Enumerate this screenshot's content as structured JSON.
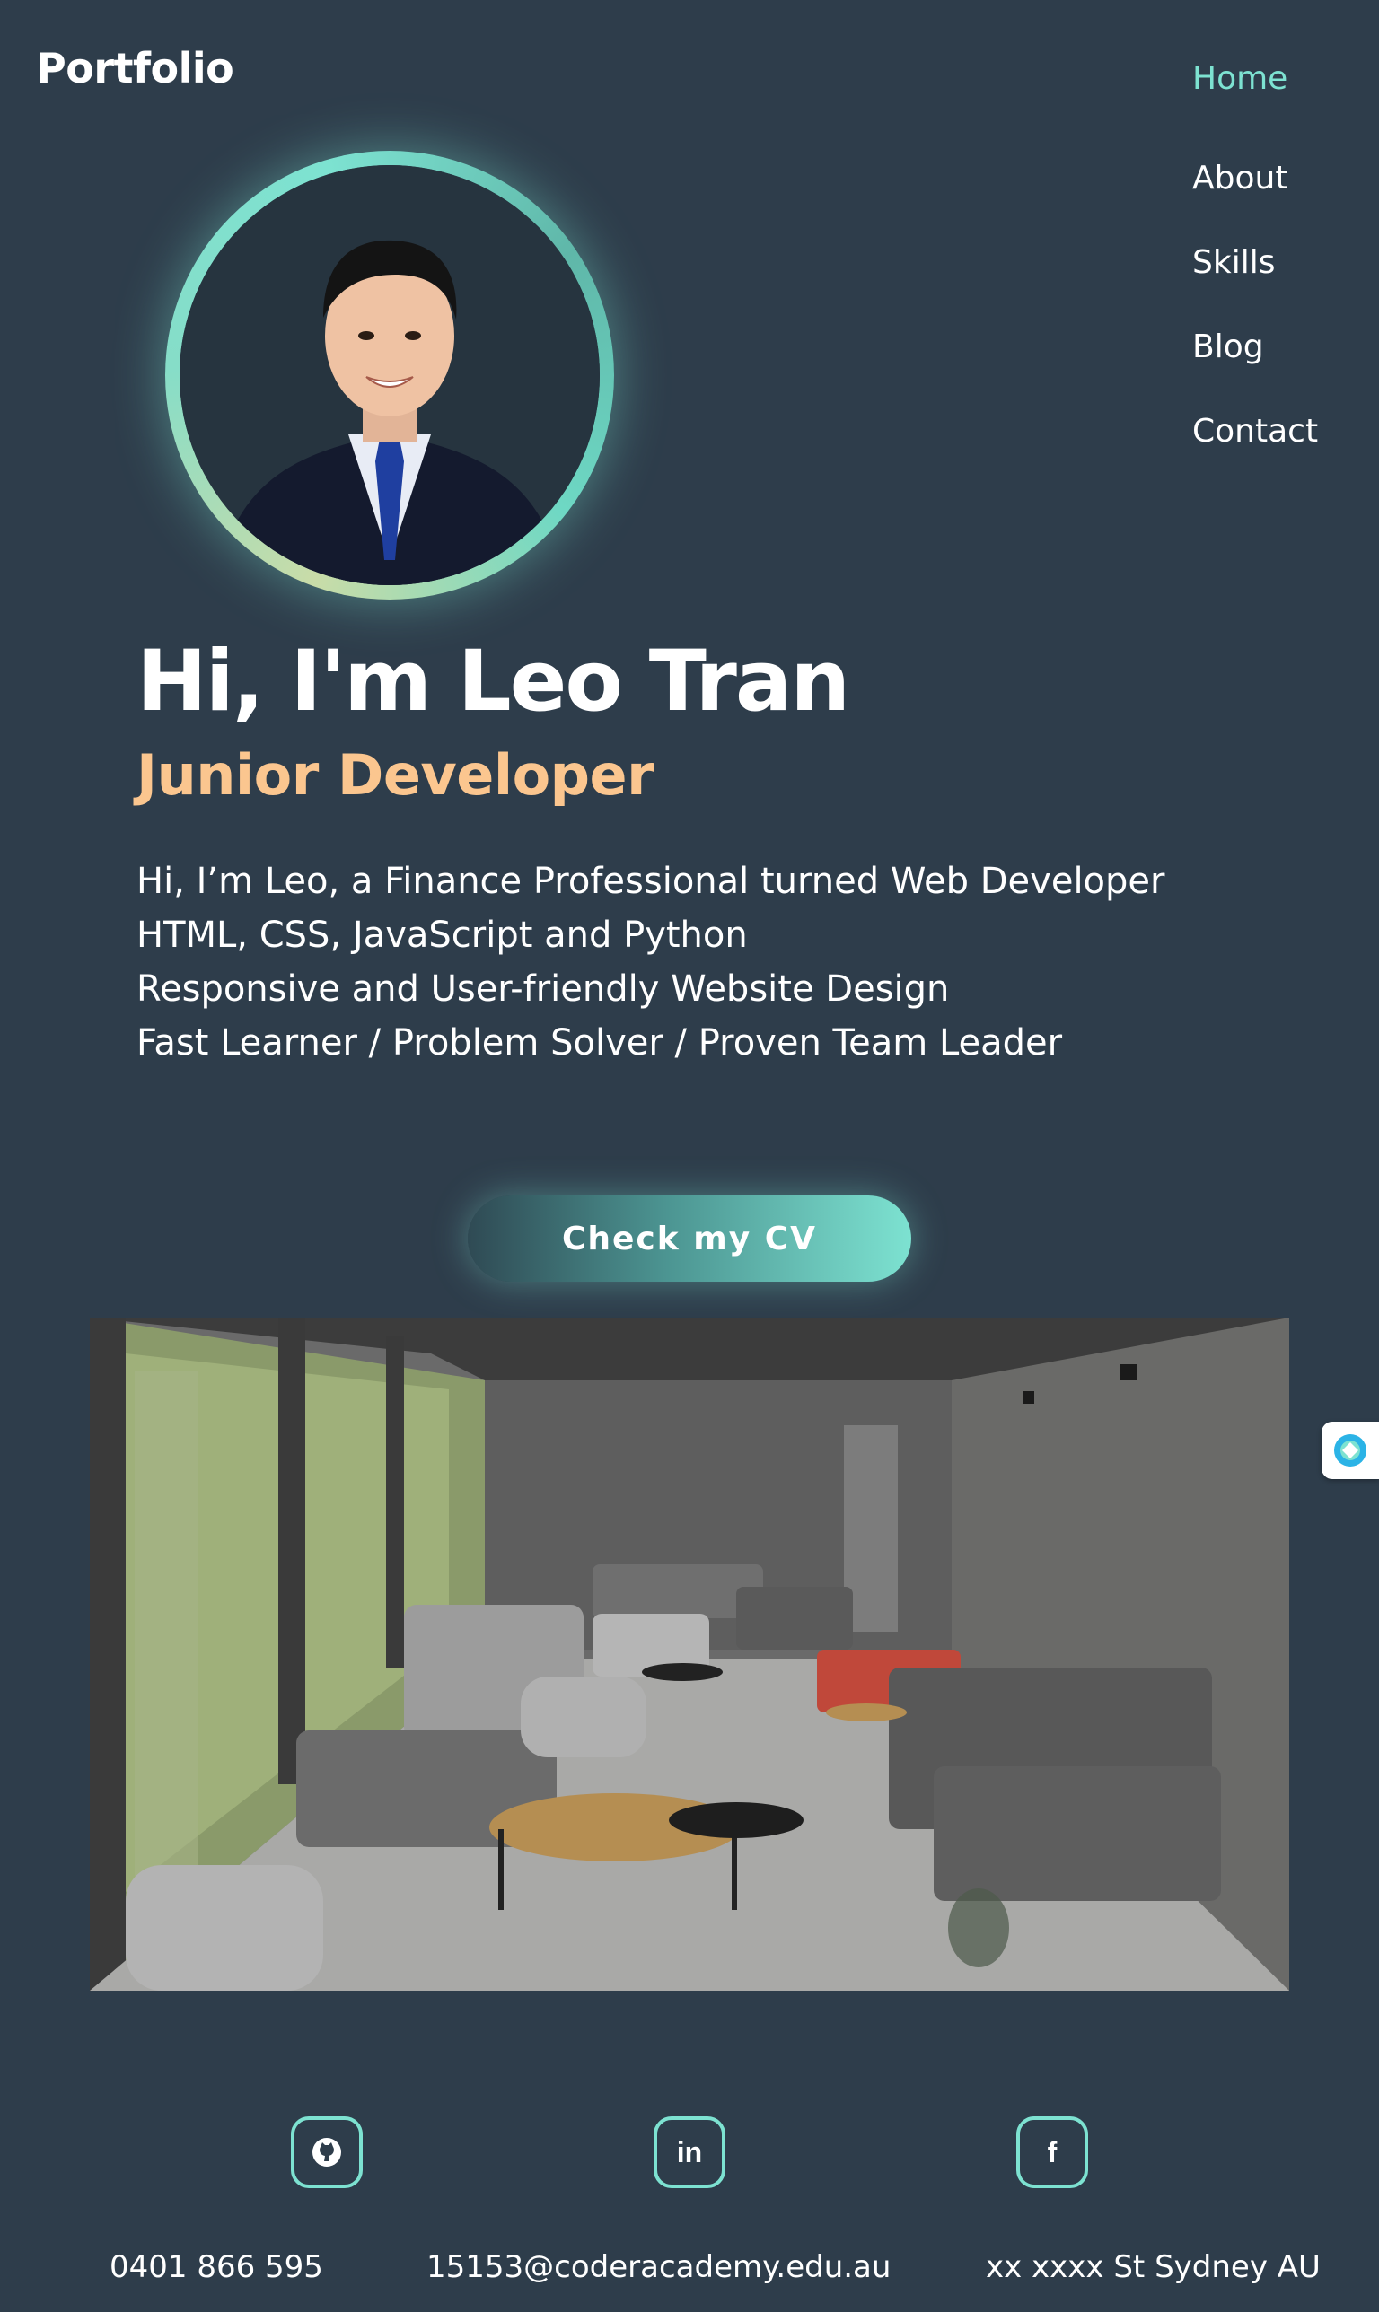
{
  "logo": {
    "text": "Portfolio"
  },
  "nav": {
    "items": [
      {
        "label": "Home",
        "active": true
      },
      {
        "label": "About",
        "active": false
      },
      {
        "label": "Skills",
        "active": false
      },
      {
        "label": "Blog",
        "active": false
      },
      {
        "label": "Contact",
        "active": false
      }
    ]
  },
  "hero": {
    "greeting": "Hi, I'm Leo Tran",
    "role": "Junior Developer",
    "bio": [
      "Hi, I’m Leo, a Finance Professional turned Web Developer",
      "HTML, CSS, JavaScript and Python",
      "Responsive and User-friendly Website Design",
      "Fast Learner / Problem Solver / Proven Team Leader"
    ],
    "cv_button": "Check my CV"
  },
  "social": {
    "items": [
      {
        "icon": "github-icon",
        "glyph": "◉"
      },
      {
        "icon": "linkedin-icon",
        "glyph": "in"
      },
      {
        "icon": "facebook-icon",
        "glyph": "f"
      }
    ]
  },
  "footer": {
    "phone": "0401 866 595",
    "email": "15153@coderacademy.edu.au",
    "address": "xx xxxx St Sydney AU"
  },
  "colors": {
    "background": "#2e3d4b",
    "accent": "#7de2d1",
    "role": "#fbc68f"
  }
}
